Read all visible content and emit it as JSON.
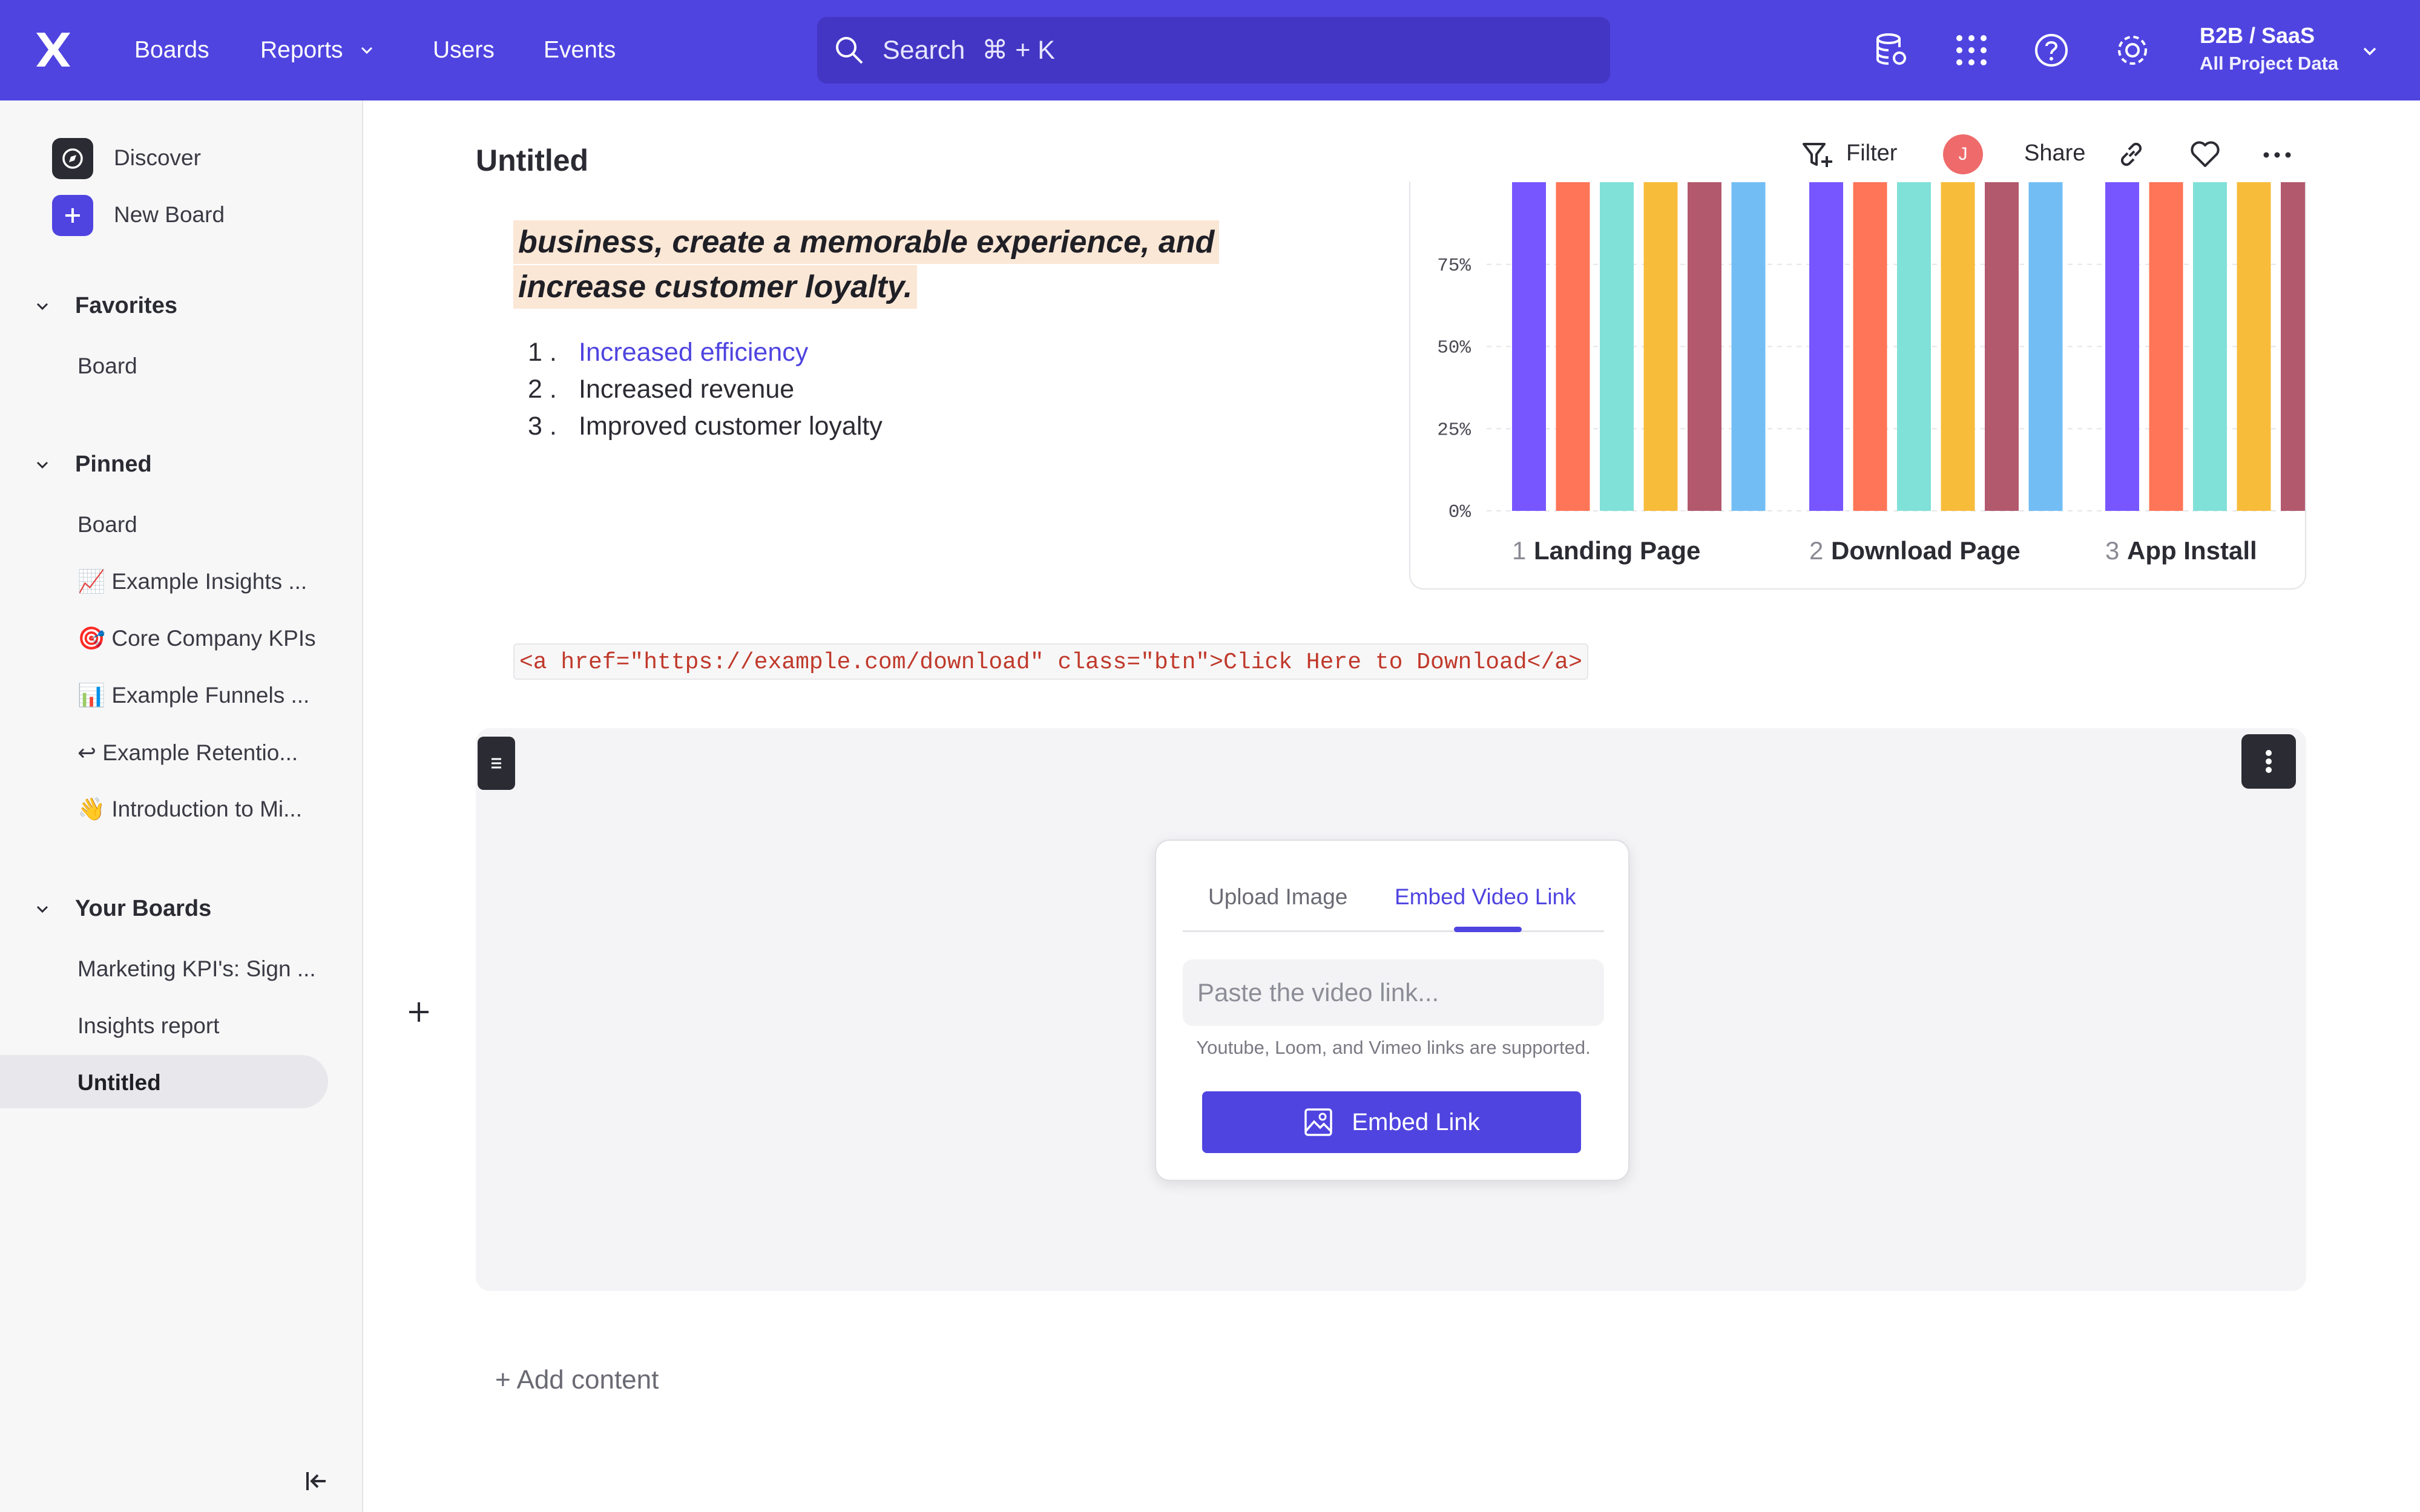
{
  "topbar": {
    "nav": [
      "Boards",
      "Reports",
      "Users",
      "Events"
    ],
    "search_label": "Search",
    "search_shortcut": "⌘ + K",
    "project_name": "B2B / SaaS",
    "project_scope": "All Project Data",
    "icons": [
      "logo-icon",
      "data-settings-icon",
      "apps-grid-icon",
      "help-icon",
      "gear-icon"
    ]
  },
  "sidebar": {
    "discover": "Discover",
    "new_board": "New Board",
    "favorites": {
      "title": "Favorites",
      "items": [
        "Board"
      ]
    },
    "pinned": {
      "title": "Pinned",
      "items": [
        "Board",
        "📈 Example Insights ...",
        "🎯 Core Company KPIs",
        "📊 Example Funnels ...",
        "↩ Example Retentio...",
        "👋 Introduction to Mi..."
      ]
    },
    "your_boards": {
      "title": "Your Boards",
      "items": [
        "Marketing KPI's: Sign ...",
        "Insights report",
        "Untitled"
      ],
      "active": "Untitled"
    }
  },
  "header": {
    "title": "Untitled",
    "filter": "Filter",
    "avatar_initial": "J",
    "share": "Share"
  },
  "content": {
    "quote_line1": "business, create a memorable experience, and",
    "quote_line2": "increase customer loyalty.",
    "list": [
      {
        "num": "1 .",
        "text": "Increased efficiency",
        "link": true
      },
      {
        "num": "2 .",
        "text": "Increased revenue",
        "link": false
      },
      {
        "num": "3 .",
        "text": "Improved customer loyalty",
        "link": false
      }
    ],
    "code": "<a href=\"https://example.com/download\" class=\"btn\">Click Here to Download</a>",
    "add_content": "+ Add content"
  },
  "embed": {
    "tab_upload": "Upload Image",
    "tab_embed": "Embed Video Link",
    "active_tab": "Embed Video Link",
    "placeholder": "Paste the video link...",
    "hint": "Youtube, Loom, and Vimeo links are supported.",
    "button": "Embed Link"
  },
  "chart_data": {
    "type": "bar",
    "categories": [
      "Landing Page",
      "Download Page",
      "App Install"
    ],
    "category_numbers": [
      "1",
      "2",
      "3"
    ],
    "yticks": [
      "75%",
      "50%",
      "25%",
      "0%"
    ],
    "ylim": [
      0,
      100
    ],
    "series_colors": [
      "#7856ff",
      "#ff7557",
      "#80e1d9",
      "#f8bc3b",
      "#b2596e",
      "#72bef4"
    ],
    "series_values": [
      [
        100,
        100,
        100,
        100,
        100,
        100
      ],
      [
        100,
        100,
        100,
        100,
        100,
        100
      ],
      [
        100,
        100,
        100,
        100,
        100
      ]
    ]
  }
}
